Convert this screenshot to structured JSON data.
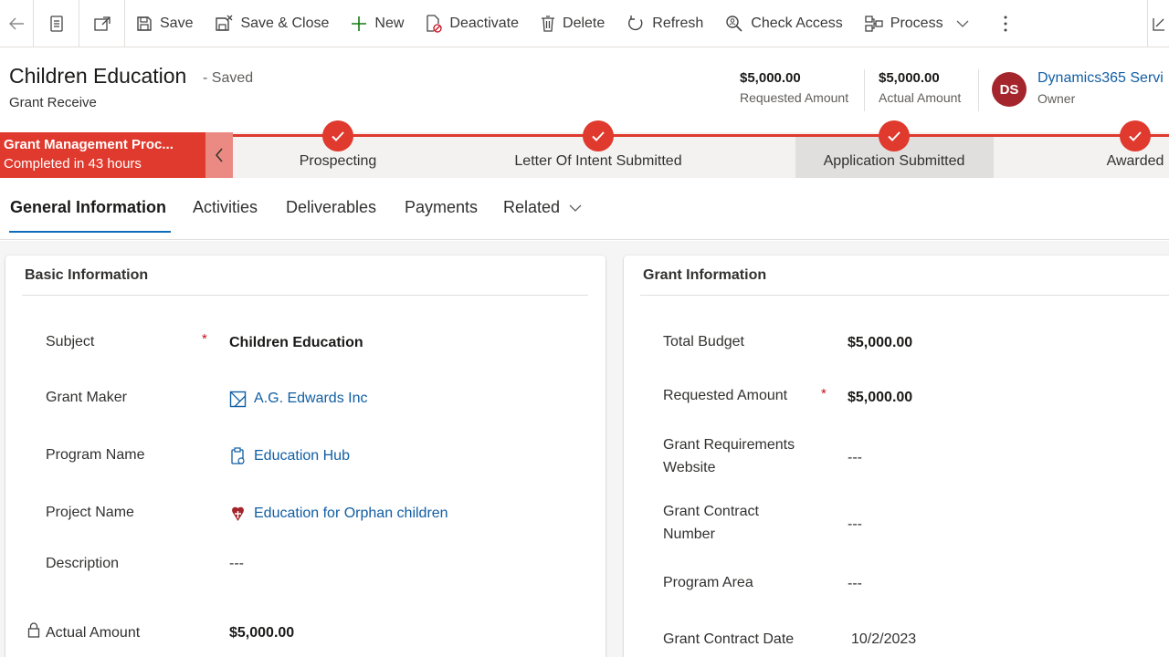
{
  "toolbar": {
    "save": "Save",
    "save_close": "Save & Close",
    "new": "New",
    "deactivate": "Deactivate",
    "delete": "Delete",
    "refresh": "Refresh",
    "check_access": "Check Access",
    "process": "Process"
  },
  "record": {
    "title": "Children Education",
    "saved_state": "- Saved",
    "entity": "Grant Receive"
  },
  "header_fields": {
    "requested_amount": {
      "value": "$5,000.00",
      "label": "Requested Amount"
    },
    "actual_amount": {
      "value": "$5,000.00",
      "label": "Actual Amount"
    },
    "owner": {
      "initials": "DS",
      "name": "Dynamics365 Servi",
      "label": "Owner"
    }
  },
  "process": {
    "name": "Grant Management Proc...",
    "status": "Completed in 43 hours",
    "stages": [
      {
        "label": "Prospecting",
        "completed": true
      },
      {
        "label": "Letter Of Intent Submitted",
        "completed": true
      },
      {
        "label": "Application Submitted",
        "completed": true,
        "active": true
      },
      {
        "label": "Awarded",
        "completed": true
      }
    ]
  },
  "tabs": [
    {
      "label": "General Information",
      "active": true
    },
    {
      "label": "Activities"
    },
    {
      "label": "Deliverables"
    },
    {
      "label": "Payments"
    },
    {
      "label": "Related"
    }
  ],
  "basic_info": {
    "title": "Basic Information",
    "fields": [
      {
        "label": "Subject",
        "value": "Children Education",
        "required": true
      },
      {
        "label": "Grant Maker",
        "value": "A.G. Edwards Inc",
        "icon": "account-icon"
      },
      {
        "label": "Program Name",
        "value": "Education Hub",
        "icon": "program-icon"
      },
      {
        "label": "Project Name",
        "value": "Education for Orphan children",
        "icon": "project-icon"
      },
      {
        "label": "Description",
        "value": "---"
      },
      {
        "label": "Actual Amount",
        "value": "$5,000.00",
        "locked": true
      }
    ]
  },
  "grant_info": {
    "title": "Grant Information",
    "fields": [
      {
        "label": "Total Budget",
        "value": "$5,000.00"
      },
      {
        "label": "Requested Amount",
        "value": "$5,000.00",
        "required": true
      },
      {
        "label": "Grant Requirements Website",
        "value": "---"
      },
      {
        "label": "Grant Contract Number",
        "value": "---"
      },
      {
        "label": "Program Area",
        "value": "---"
      },
      {
        "label": "Grant Contract Date",
        "value": "10/2/2023"
      }
    ]
  },
  "required_marker": "*",
  "colors": {
    "process_red": "#e0392d",
    "link_blue": "#115ea3",
    "avatar": "#a4262c",
    "tab_underline": "#0f6cbd"
  }
}
